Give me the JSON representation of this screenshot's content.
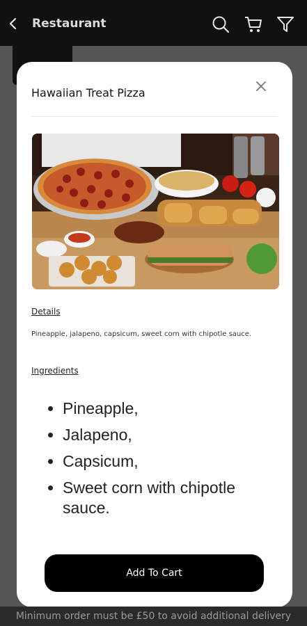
{
  "header": {
    "title": "Restaurant",
    "icons": [
      "back-arrow-icon",
      "search-icon",
      "cart-icon",
      "filter-icon"
    ]
  },
  "modal": {
    "title": "Hawaiian Treat Pizza",
    "image_alt": "Pizza with wings, sandwich and sides",
    "details_heading": "Details",
    "details_text": "Pineapple, jalapeno, capsicum, sweet corn with chipotle sauce.",
    "ingredients_heading": "Ingredients",
    "ingredients": [
      "Pineapple,",
      "Jalapeno,",
      "Capsicum,",
      "Sweet corn with chipotle sauce."
    ],
    "add_to_cart_label": "Add To Cart"
  },
  "banner": {
    "text": "Minimum order must be £50 to avoid additional delivery"
  },
  "colors": {
    "topbar": "#111111",
    "overlay": "#555555",
    "button": "#000000",
    "modal": "#ffffff"
  }
}
